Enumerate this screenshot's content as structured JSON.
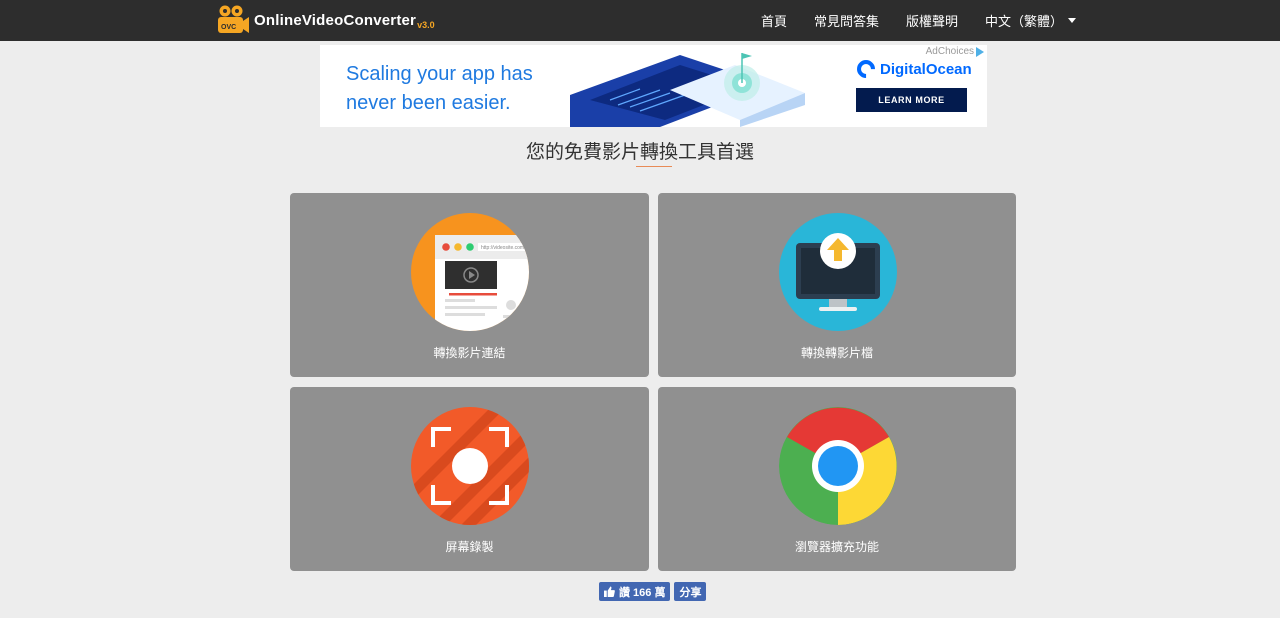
{
  "header": {
    "logo": {
      "main": "OnlineVideoConverter",
      "version": "v3.0",
      "badge": "OVC"
    },
    "nav": [
      {
        "label": "首頁"
      },
      {
        "label": "常見問答集"
      },
      {
        "label": "版權聲明"
      },
      {
        "label": "中文（繁體）",
        "has_dropdown": true
      }
    ]
  },
  "ad": {
    "headline_line1": "Scaling your app has",
    "headline_line2": "never been easier.",
    "adchoices": "AdChoices",
    "brand": "DigitalOcean",
    "cta": "LEARN MORE"
  },
  "main": {
    "title": "您的免費影片轉換工具首選",
    "cards": [
      {
        "label": "轉換影片連結",
        "icon": "browser-video-icon",
        "color": "#f7931e"
      },
      {
        "label": "轉換轉影片檔",
        "icon": "monitor-upload-icon",
        "color": "#29b6d8"
      },
      {
        "label": "屏幕錄製",
        "icon": "screen-record-icon",
        "color": "#f25a29"
      },
      {
        "label": "瀏覽器擴充功能",
        "icon": "chrome-icon",
        "color": "#4caf50"
      }
    ]
  },
  "social": {
    "like_label": "讚 166 萬",
    "share_label": "分享"
  }
}
